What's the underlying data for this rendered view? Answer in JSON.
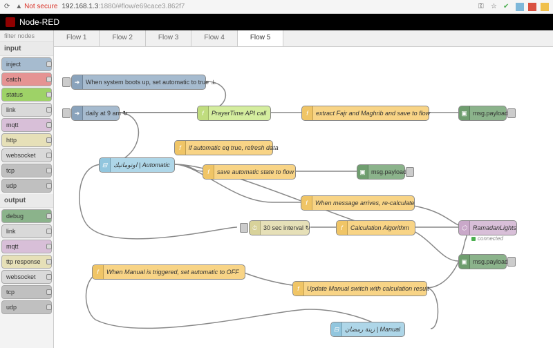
{
  "browser": {
    "notSecure": "Not secure",
    "url_host": "192.168.1.3",
    "url_port": ":1880",
    "url_path": "/#flow/e69cace3.862f7"
  },
  "app": {
    "title": "Node-RED",
    "filterPlaceholder": "filter nodes"
  },
  "palette": {
    "cat_input": "input",
    "cat_output": "output",
    "inject": "inject",
    "catch": "catch",
    "status": "status",
    "link": "link",
    "mqtt": "mqtt",
    "http": "http",
    "websocket": "websocket",
    "tcp": "tcp",
    "udp": "udp",
    "debug": "debug",
    "link2": "link",
    "mqtt2": "mqtt",
    "httpresp": "ttp response",
    "websocket2": "websocket",
    "tcp2": "tcp",
    "udp2": "udp"
  },
  "tabs": [
    "Flow 1",
    "Flow 2",
    "Flow 3",
    "Flow 4",
    "Flow 5"
  ],
  "activeTab": 4,
  "nodes": {
    "boot": "When system boots up, set automatic to true ⊥",
    "daily": "daily at 9 am ↻",
    "prayer": "PrayerTime API call",
    "extract": "extract Fajr and Maghrib and save to flow",
    "debug1": "msg.payload",
    "ifauto": "if automatic eq true, refresh data",
    "autoSwitch": "اوتوماتيك | Automatic",
    "saveauto": "save automatic state to flow",
    "debug2": "msg.payload",
    "recalc": "When message arrives, re-calculate",
    "interval": "30 sec interval ↻",
    "calc": "Calculation Algorithm",
    "ramadan": "RamadanLights",
    "connected": "connected",
    "debug3": "msg.payload",
    "manualTrig": "When Manual is triggered, set automatic to OFF",
    "updateManual": "Update Manual switch with calculation result",
    "manualSwitch": "زينة رمضان | Manual"
  },
  "colors": {
    "palette": {
      "inject": "#a6bbcf",
      "catch": "#e59393",
      "status": "#9ed267",
      "link": "#d9d9d9",
      "mqtt": "#d8bfd8",
      "http": "#e6e0b8",
      "websocket": "#d9d9d9",
      "tcp": "#c0c0c0",
      "udp": "#c0c0c0",
      "debug": "#8bb38b",
      "httpresp": "#e6e0b8"
    }
  }
}
